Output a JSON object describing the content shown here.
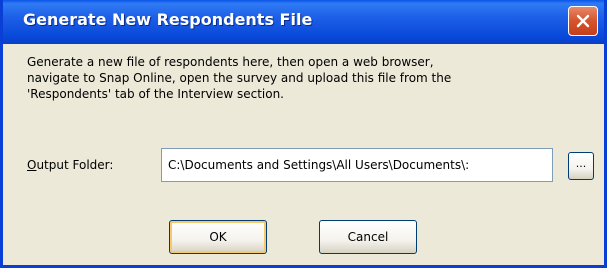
{
  "window": {
    "title": "Generate New Respondents File",
    "close_icon": "close-icon"
  },
  "description": {
    "line1": "Generate a new file of respondents here, then open a web browser,",
    "line2": "navigate to Snap Online, open the survey and upload this file from the",
    "line3": "'Respondents' tab of the Interview section."
  },
  "output_folder": {
    "label_prefix": "",
    "label_accel": "O",
    "label_rest": "utput Folder:",
    "value": "C:\\Documents and Settings\\All Users\\Documents\\:",
    "browse_label": "..."
  },
  "buttons": {
    "ok_label": "OK",
    "cancel_label": "Cancel"
  },
  "colors": {
    "titlebar": "#0a55e6",
    "dialog_bg": "#ece9d8",
    "close_button": "#d6532d"
  }
}
